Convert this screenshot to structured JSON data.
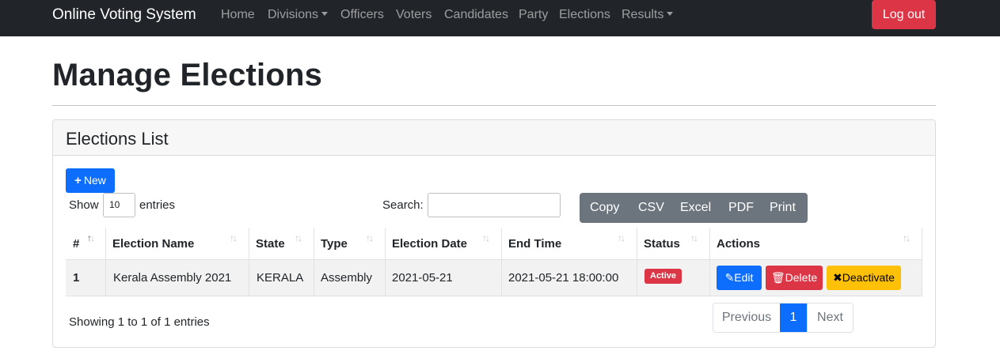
{
  "navbar": {
    "brand": "Online Voting System",
    "items": [
      {
        "label": "Home",
        "dropdown": false
      },
      {
        "label": "Divisions",
        "dropdown": true
      },
      {
        "label": "Officers",
        "dropdown": false
      },
      {
        "label": "Voters",
        "dropdown": false
      },
      {
        "label": "Candidates",
        "dropdown": false
      },
      {
        "label": "Party",
        "dropdown": false
      },
      {
        "label": "Elections",
        "dropdown": false
      },
      {
        "label": "Results",
        "dropdown": true
      }
    ],
    "logout_label": "Log out"
  },
  "page": {
    "title": "Manage Elections"
  },
  "card": {
    "title": "Elections List",
    "new_button": "New",
    "show_label": "Show",
    "entries_value": "10",
    "entries_label": "entries",
    "search_label": "Search:",
    "search_value": "",
    "export_buttons": [
      "Copy",
      "CSV",
      "Excel",
      "PDF",
      "Print"
    ]
  },
  "table": {
    "columns": [
      "#",
      "Election Name",
      "State",
      "Type",
      "Election Date",
      "End Time",
      "Status",
      "Actions"
    ],
    "rows": [
      {
        "num": "1",
        "name": "Kerala Assembly 2021",
        "state": "KERALA",
        "type": "Assembly",
        "date": "2021-05-21",
        "end": "2021-05-21 18:00:00",
        "status": "Active",
        "actions": {
          "edit": "Edit",
          "delete": "Delete",
          "deactivate": "Deactivate"
        }
      }
    ]
  },
  "footer": {
    "showing": "Showing 1 to 1 of 1 entries",
    "previous": "Previous",
    "page": "1",
    "next": "Next"
  },
  "colors": {
    "navbar_bg": "#212529",
    "primary": "#0d6efd",
    "danger": "#dc3545",
    "warning": "#ffc107",
    "secondary": "#6c757d"
  }
}
